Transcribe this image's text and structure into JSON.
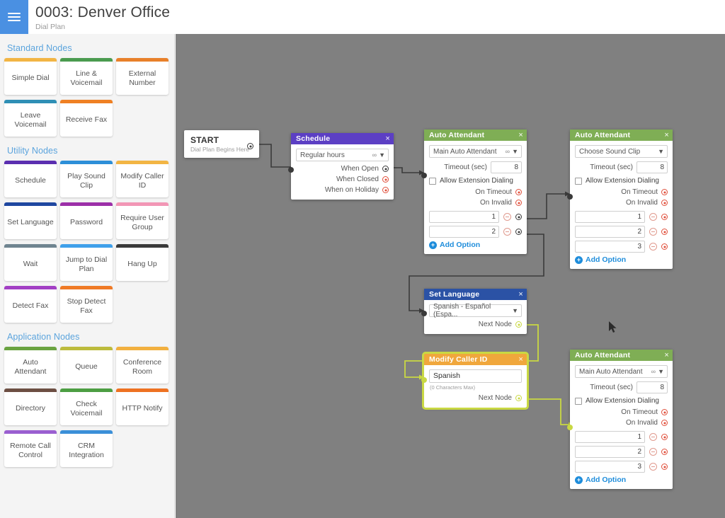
{
  "header": {
    "menu_icon": "hamburger-icon",
    "title": "0003: Denver Office",
    "subtitle": "Dial Plan",
    "accent_color": "#4a90e2"
  },
  "sidebar": {
    "sections": [
      {
        "title": "Standard Nodes",
        "nodes": [
          {
            "label": "Simple Dial",
            "color": "#f2b544"
          },
          {
            "label": "Line & Voicemail",
            "color": "#4a9b4f"
          },
          {
            "label": "External Number",
            "color": "#e8802a"
          },
          {
            "label": "Leave Voicemail",
            "color": "#2f8fb5"
          },
          {
            "label": "Receive Fax",
            "color": "#ef8023"
          }
        ]
      },
      {
        "title": "Utility Nodes",
        "nodes": [
          {
            "label": "Schedule",
            "color": "#5b2fb0"
          },
          {
            "label": "Play Sound Clip",
            "color": "#2d8fd8"
          },
          {
            "label": "Modify Caller ID",
            "color": "#f2b544"
          },
          {
            "label": "Set Language",
            "color": "#1f47a0"
          },
          {
            "label": "Password",
            "color": "#9c2fa8"
          },
          {
            "label": "Require User Group",
            "color": "#f296b5"
          },
          {
            "label": "Wait",
            "color": "#6f8490"
          },
          {
            "label": "Jump to Dial Plan",
            "color": "#3fa0ea"
          },
          {
            "label": "Hang Up",
            "color": "#3a3a3a"
          },
          {
            "label": "Detect Fax",
            "color": "#a23fc4"
          },
          {
            "label": "Stop Detect Fax",
            "color": "#ef7a26"
          }
        ]
      },
      {
        "title": "Application Nodes",
        "nodes": [
          {
            "label": "Auto Attendant",
            "color": "#6aa340"
          },
          {
            "label": "Queue",
            "color": "#bcbb3c"
          },
          {
            "label": "Conference Room",
            "color": "#f2b03f"
          },
          {
            "label": "Directory",
            "color": "#6d4f43"
          },
          {
            "label": "Check Voicemail",
            "color": "#4d9e43"
          },
          {
            "label": "HTTP Notify",
            "color": "#ee7222"
          },
          {
            "label": "Remote Call Control",
            "color": "#9a5fd0"
          },
          {
            "label": "CRM Integration",
            "color": "#3b8fd8"
          }
        ]
      }
    ]
  },
  "canvas": {
    "background_color": "#808080",
    "selection_color": "#c9d843",
    "start_node": {
      "title": "START",
      "subtitle": "Dial Plan Begins Here"
    },
    "nodes": [
      {
        "id": "schedule",
        "title": "Schedule",
        "header_color": "#5c3fc4",
        "close_label": "×",
        "select_value": "Regular hours",
        "ports": [
          {
            "label": "When Open",
            "style": "dark"
          },
          {
            "label": "When Closed",
            "style": "red"
          },
          {
            "label": "When on Holiday",
            "style": "red"
          }
        ]
      },
      {
        "id": "auto-attendant-1",
        "title": "Auto Attendant",
        "header_color": "#7fae55",
        "close_label": "×",
        "select_value": "Main Auto Attendant",
        "timeout_label": "Timeout (sec)",
        "timeout_value": "8",
        "checkbox_label": "Allow Extension Dialing",
        "checkbox_checked": false,
        "ports": [
          {
            "label": "On Timeout",
            "style": "red"
          },
          {
            "label": "On Invalid",
            "style": "red"
          }
        ],
        "options": [
          {
            "value": "1",
            "port_style": "dark"
          },
          {
            "value": "2",
            "port_style": "dark"
          }
        ],
        "add_option_label": "Add Option"
      },
      {
        "id": "auto-attendant-2",
        "title": "Auto Attendant",
        "header_color": "#7fae55",
        "close_label": "×",
        "select_value": "Choose Sound Clip",
        "timeout_label": "Timeout (sec)",
        "timeout_value": "8",
        "checkbox_label": "Allow Extension Dialing",
        "checkbox_checked": false,
        "ports": [
          {
            "label": "On Timeout",
            "style": "red"
          },
          {
            "label": "On Invalid",
            "style": "red"
          }
        ],
        "options": [
          {
            "value": "1",
            "port_style": "red"
          },
          {
            "value": "2",
            "port_style": "red"
          },
          {
            "value": "3",
            "port_style": "red"
          }
        ],
        "add_option_label": "Add Option"
      },
      {
        "id": "set-language",
        "title": "Set Language",
        "header_color": "#2b52a5",
        "close_label": "×",
        "select_value": "Spanish - Español (Espa...",
        "ports": [
          {
            "label": "Next Node",
            "style": "lime"
          }
        ]
      },
      {
        "id": "modify-caller-id",
        "title": "Modify Caller ID",
        "header_color": "#f0a73c",
        "close_label": "×",
        "selected": true,
        "text_value": "Spanish",
        "hint": "(0 Characters Max)",
        "ports": [
          {
            "label": "Next Node",
            "style": "lime"
          }
        ]
      },
      {
        "id": "auto-attendant-3",
        "title": "Auto Attendant",
        "header_color": "#7fae55",
        "close_label": "×",
        "select_value": "Main Auto Attendant",
        "timeout_label": "Timeout (sec)",
        "timeout_value": "8",
        "checkbox_label": "Allow Extension Dialing",
        "checkbox_checked": false,
        "ports": [
          {
            "label": "On Timeout",
            "style": "red"
          },
          {
            "label": "On Invalid",
            "style": "red"
          }
        ],
        "options": [
          {
            "value": "1",
            "port_style": "red"
          },
          {
            "value": "2",
            "port_style": "red"
          },
          {
            "value": "3",
            "port_style": "red"
          }
        ],
        "add_option_label": "Add Option"
      }
    ]
  }
}
